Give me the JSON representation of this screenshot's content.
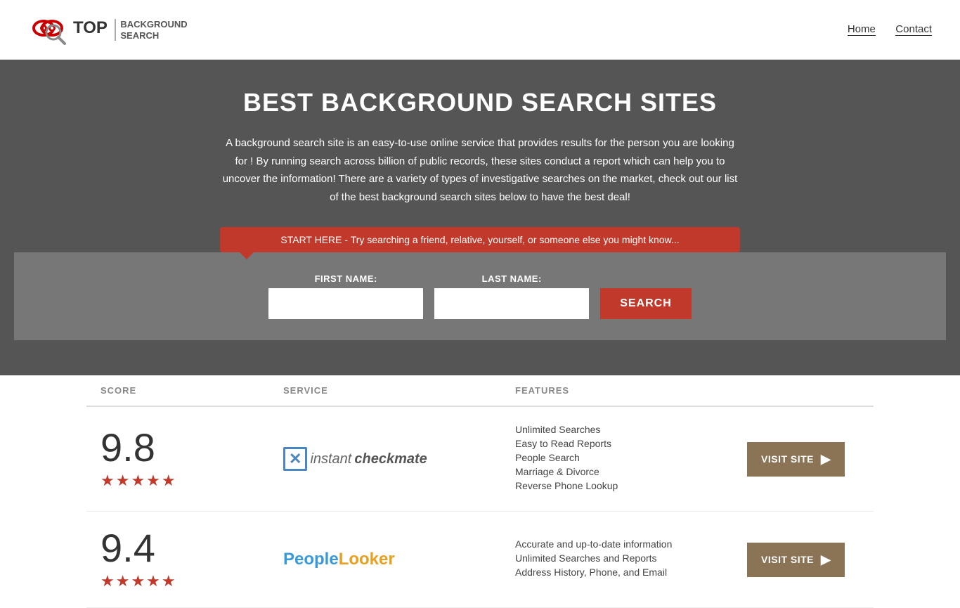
{
  "nav": {
    "logo_top": "TOP",
    "logo_sub": "BACKGROUND\nSEARCH",
    "links": [
      {
        "label": "Home",
        "href": "#"
      },
      {
        "label": "Contact",
        "href": "#"
      }
    ]
  },
  "hero": {
    "title": "BEST BACKGROUND SEARCH SITES",
    "description": "A background search site is an easy-to-use online service that provides results  for the person you are looking for ! By  running  search across billion of public records, these sites conduct  a report which can help you to uncover the information! There are a variety of types of investigative searches on the market, check out our  list of the best background search sites below to have the best deal!",
    "bubble_text": "START HERE - Try searching a friend, relative, yourself, or someone else you might know...",
    "form": {
      "first_name_label": "FIRST NAME:",
      "last_name_label": "LAST NAME:",
      "search_button": "SEARCH"
    }
  },
  "table": {
    "headers": {
      "score": "SCORE",
      "service": "SERVICE",
      "features": "FEATURES",
      "action": ""
    },
    "rows": [
      {
        "score": "9.8",
        "stars": "★★★★★",
        "service_name": "Instant Checkmate",
        "features": [
          "Unlimited Searches",
          "Easy to Read Reports",
          "People Search",
          "Marriage & Divorce",
          "Reverse Phone Lookup"
        ],
        "button_label": "VISIT SITE"
      },
      {
        "score": "9.4",
        "stars": "★★★★★",
        "service_name": "PeopleLooker",
        "features": [
          "Accurate and up-to-date information",
          "Unlimited Searches and Reports",
          "Address History, Phone, and Email"
        ],
        "button_label": "VISIT SITE"
      }
    ]
  }
}
